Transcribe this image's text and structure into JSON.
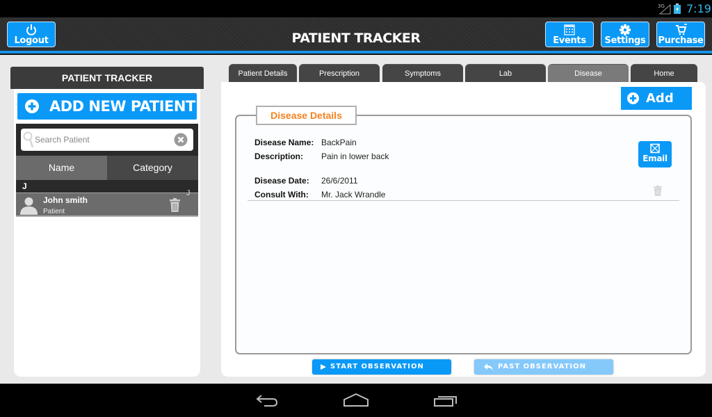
{
  "status_bar": {
    "network": "3G",
    "time": "7:19",
    "time_color": "#33b5e5"
  },
  "header": {
    "title": "PATIENT TRACKER",
    "accent_color": "#0a99f7",
    "buttons": {
      "logout": {
        "label": "Logout",
        "icon": "power-icon"
      },
      "events": {
        "label": "Events",
        "icon": "calendar-icon"
      },
      "settings": {
        "label": "Settings",
        "icon": "gear-icon"
      },
      "purchase": {
        "label": "Purchase",
        "icon": "cart-icon"
      }
    }
  },
  "sidebar": {
    "title": "PATIENT TRACKER",
    "add_button_label": "ADD NEW PATIENT",
    "search": {
      "placeholder": "Search Patient",
      "value": ""
    },
    "sort_tabs": [
      {
        "label": "Name",
        "active": true
      },
      {
        "label": "Category",
        "active": false
      }
    ],
    "sections": [
      {
        "letter": "J",
        "patients": [
          {
            "name": "John smith",
            "category": "Patient",
            "index_letter": "J"
          }
        ]
      }
    ]
  },
  "main": {
    "tabs": [
      {
        "label": "Patient Details",
        "active": false
      },
      {
        "label": "Prescription",
        "active": false
      },
      {
        "label": "Symptoms",
        "active": false
      },
      {
        "label": "Lab",
        "active": false
      },
      {
        "label": "Disease",
        "active": true
      },
      {
        "label": "Home",
        "active": false
      }
    ],
    "add_button_label": "Add",
    "section_title": "Disease Details",
    "section_title_color": "#f5821f",
    "record": {
      "fields": [
        {
          "label": "Disease Name:",
          "value": "BackPain"
        },
        {
          "label": "Description:",
          "value": "Pain in lower back"
        },
        {
          "label": "Disease Date:",
          "value": "26/6/2011"
        },
        {
          "label": "Consult With:",
          "value": "Mr. Jack Wrandle"
        }
      ],
      "email_button_label": "Email"
    },
    "start_observation_label": "START OBSERVATION",
    "past_observation_label": "PAST OBSERVATION"
  },
  "nav_bar": {
    "buttons": [
      "back",
      "home",
      "recent-apps"
    ]
  }
}
